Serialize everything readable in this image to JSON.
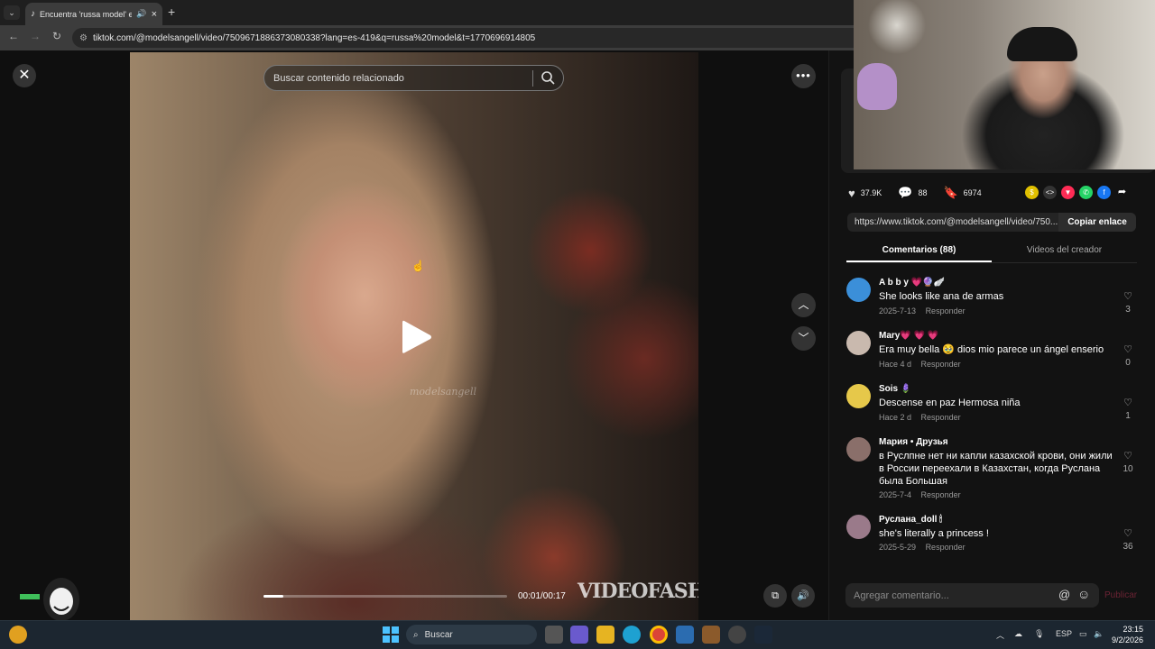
{
  "browser": {
    "tab_title": "Encuentra 'russa model' en",
    "url": "tiktok.com/@modelsangell/video/7509671886373080338?lang=es-419&q=russa%20model&t=1770696914805"
  },
  "video": {
    "search_placeholder": "Buscar contenido relacionado",
    "time_display": "00:01/00:17",
    "progress_fraction": 0.08,
    "watermark_handle": "modelsangell",
    "watermark_brand": "VIDEOFASHION!"
  },
  "actions": {
    "likes": "37.9K",
    "comments": "88",
    "saves": "6974"
  },
  "share": {
    "link": "https://www.tiktok.com/@modelsangell/video/750...",
    "copy_label": "Copiar enlace"
  },
  "tabs": {
    "comments": "Comentarios (88)",
    "creator_videos": "Videos del creador"
  },
  "comments": [
    {
      "user": "A b b y 💗🔮🪽",
      "text": "She looks like ana de armas",
      "date": "2025-7-13",
      "reply": "Responder",
      "likes": "3",
      "avatar_color": "#3b8fd9"
    },
    {
      "user": "Mary💗 💗 💗",
      "text": "Era muy bella 🥹 dios mio parece un ángel enserio",
      "date": "Hace 4 d",
      "reply": "Responder",
      "likes": "0",
      "avatar_color": "#c9b9ae"
    },
    {
      "user": "Sois 🪻",
      "text": "Descense en paz Hermosa niña",
      "date": "Hace 2 d",
      "reply": "Responder",
      "likes": "1",
      "avatar_color": "#e6c84a"
    },
    {
      "user": "Мария • Друзья",
      "text": "в Руслпне нет ни капли казахской крови, они жили в России переехали в Казахстан, когда Руслана была Большая",
      "date": "2025-7-4",
      "reply": "Responder",
      "likes": "10",
      "avatar_color": "#8a6f6a"
    },
    {
      "user": "Руслана_doll 🕯",
      "text": "she's literally a princess !",
      "date": "2025-5-29",
      "reply": "Responder",
      "likes": "36",
      "avatar_color": "#9a7a8a"
    }
  ],
  "add_comment": {
    "placeholder": "Agregar comentario...",
    "publish": "Publicar"
  },
  "taskbar": {
    "search": "Buscar",
    "lang": "ESP",
    "time": "23:15",
    "date": "9/2/2026"
  },
  "colors": {
    "accent": "#fe2c55",
    "background": "#121212",
    "panel": "#1e1e1e"
  }
}
